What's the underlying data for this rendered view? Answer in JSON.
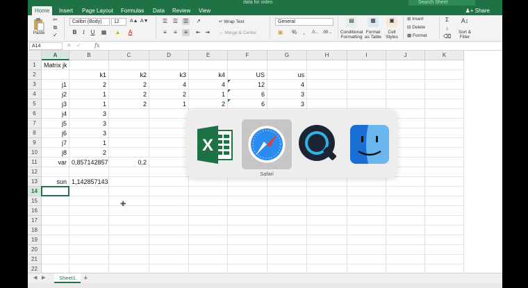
{
  "window": {
    "title": "data for video",
    "search_placeholder": "Search Sheet",
    "share_label": "Share"
  },
  "tabs": [
    "Home",
    "Insert",
    "Page Layout",
    "Formulas",
    "Data",
    "Review",
    "View"
  ],
  "ribbon": {
    "paste": "Paste",
    "font_name": "Calibri (Body)",
    "font_size": "12",
    "wrap_text": "Wrap Text",
    "merge_center": "Merge & Center",
    "number_format": "General",
    "conditional_formatting": "Conditional Formatting",
    "format_as_table": "Format as Table",
    "cell_styles": "Cell Styles",
    "insert": "Insert",
    "delete": "Delete",
    "format": "Format",
    "sort_filter": "Sort & Filter"
  },
  "formula_bar": {
    "name_box": "A14",
    "fx": "fx",
    "content": ""
  },
  "columns": [
    "A",
    "B",
    "C",
    "D",
    "E",
    "F",
    "G",
    "H",
    "I",
    "J",
    "K"
  ],
  "rows": [
    "1",
    "2",
    "3",
    "4",
    "5",
    "6",
    "7",
    "8",
    "9",
    "10",
    "11",
    "12",
    "13",
    "14",
    "15",
    "16",
    "17",
    "18",
    "19",
    "20",
    "21",
    "22",
    "23"
  ],
  "cells": {
    "A1": "Matrix jk",
    "B2": "k1",
    "C2": "k2",
    "D2": "k3",
    "E2": "k4",
    "F2": "US",
    "G2": "us",
    "A3": "j1",
    "B3": "2",
    "C3": "2",
    "D3": "4",
    "E3": "4",
    "F3": "12",
    "G3": "4",
    "A4": "j2",
    "B4": "1",
    "C4": "2",
    "D4": "2",
    "E4": "1",
    "F4": "6",
    "G4": "3",
    "A5": "j3",
    "B5": "1",
    "C5": "2",
    "D5": "1",
    "E5": "2",
    "F5": "6",
    "G5": "3",
    "A6": "j4",
    "B6": "3",
    "A7": "j5",
    "B7": "3",
    "A8": "j6",
    "B8": "3",
    "A9": "j7",
    "B9": "1",
    "A10": "j8",
    "B10": "2",
    "A11": "var",
    "B11": "0,857142857",
    "C11": "0,2",
    "A13": "sun",
    "B13": "1,142857143"
  },
  "sheet_tabs": [
    "Sheet1"
  ],
  "add_sheet": "+",
  "app_switcher": {
    "apps": [
      "excel-icon",
      "safari-icon",
      "quicktime-icon",
      "finder-icon"
    ],
    "selected_label": "Safari"
  },
  "colors": {
    "excel_green": "#1f7244",
    "selection": "#1f7244"
  }
}
